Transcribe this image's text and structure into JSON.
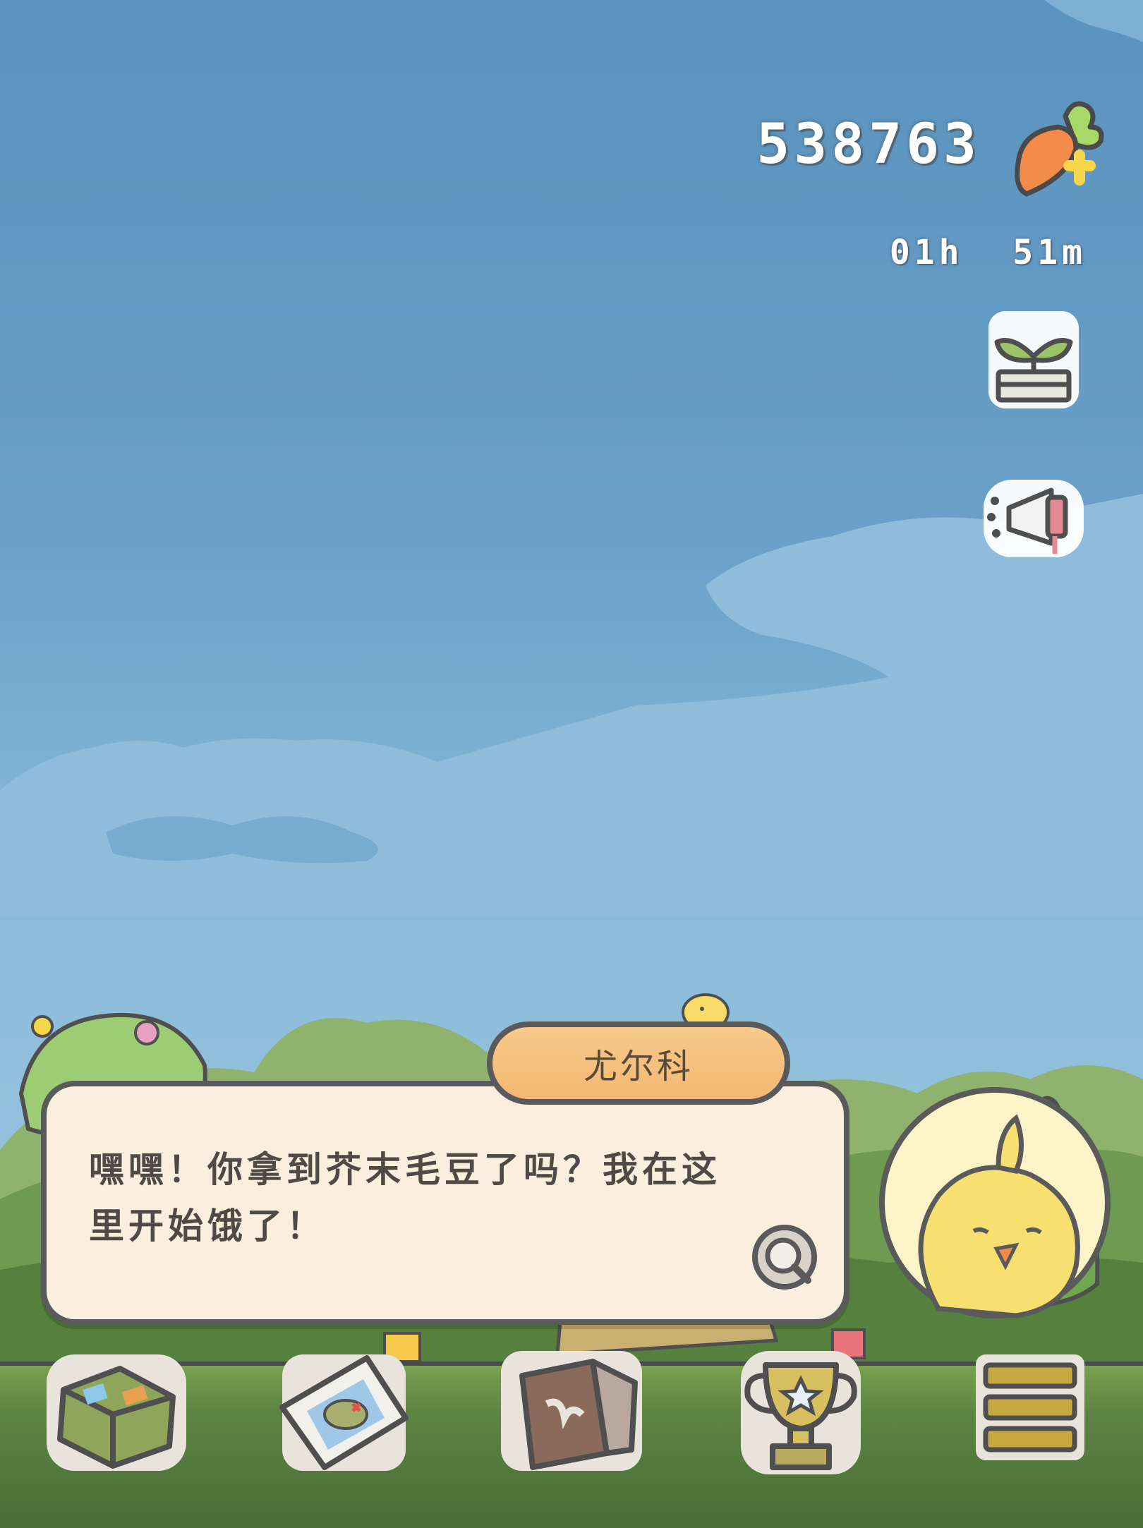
{
  "hud": {
    "carrot_count": "538763",
    "timer": "01h  51m",
    "carrot_icon": "carrot-plus-icon",
    "planting_icon": "sprout-pot-icon",
    "announce_icon": "megaphone-icon"
  },
  "dialog": {
    "speaker": "尤尔科",
    "text_line1": "嘿嘿！你拿到芥末毛豆了吗？我在这",
    "text_line2": "里开始饿了！",
    "magnify_icon": "magnifier-icon",
    "portrait_icon": "yellow-chick-portrait"
  },
  "bottom_nav": [
    {
      "icon": "suitcase-icon"
    },
    {
      "icon": "map-icon"
    },
    {
      "icon": "journal-icon"
    },
    {
      "icon": "trophy-icon"
    },
    {
      "icon": "menu-icon"
    }
  ],
  "colors": {
    "sky": "#6aa0c9",
    "dialog_bg": "#faefdf",
    "name_tab": "#f3b872",
    "outline": "#5a5a5a",
    "grass": "#6f984a"
  }
}
